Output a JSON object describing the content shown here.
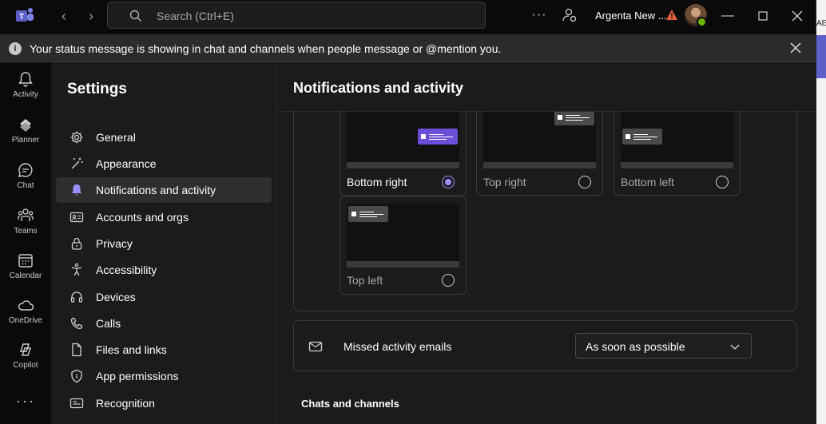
{
  "titlebar": {
    "search_placeholder": "Search (Ctrl+E)",
    "more_label": "···",
    "org_name": "Argenta New ..."
  },
  "right_strip": {
    "text": "AE"
  },
  "infobar": {
    "message": "Your status message is showing in chat and channels when people message or @mention you."
  },
  "rail": {
    "items": [
      {
        "label": "Activity",
        "icon": "bell-icon"
      },
      {
        "label": "Planner",
        "icon": "planner-icon"
      },
      {
        "label": "Chat",
        "icon": "chat-icon"
      },
      {
        "label": "Teams",
        "icon": "teams-icon"
      },
      {
        "label": "Calendar",
        "icon": "calendar-icon"
      },
      {
        "label": "OneDrive",
        "icon": "cloud-icon"
      },
      {
        "label": "Copilot",
        "icon": "copilot-icon"
      }
    ],
    "more": "···"
  },
  "settings": {
    "title": "Settings",
    "items": [
      {
        "label": "General",
        "icon": "gear-icon"
      },
      {
        "label": "Appearance",
        "icon": "magic-wand-icon"
      },
      {
        "label": "Notifications and activity",
        "icon": "bell-icon",
        "active": true
      },
      {
        "label": "Accounts and orgs",
        "icon": "id-card-icon"
      },
      {
        "label": "Privacy",
        "icon": "lock-icon"
      },
      {
        "label": "Accessibility",
        "icon": "accessibility-icon"
      },
      {
        "label": "Devices",
        "icon": "headset-icon"
      },
      {
        "label": "Calls",
        "icon": "phone-icon"
      },
      {
        "label": "Files and links",
        "icon": "document-icon"
      },
      {
        "label": "App permissions",
        "icon": "shield-icon"
      },
      {
        "label": "Recognition",
        "icon": "recognition-icon"
      }
    ]
  },
  "main": {
    "title": "Notifications and activity",
    "positions": [
      {
        "label": "Bottom right",
        "selected": true
      },
      {
        "label": "Top right",
        "selected": false
      },
      {
        "label": "Bottom left",
        "selected": false
      },
      {
        "label": "Top left",
        "selected": false
      }
    ],
    "missed": {
      "label": "Missed activity emails",
      "value": "As soon as possible"
    },
    "section_chats": "Chats and channels"
  },
  "colors": {
    "accent": "#5b5fc7",
    "selected_toast": "#6b4fd8",
    "radio_checked": "#9b8fff",
    "presence": "#6bb700",
    "warning": "#e8603c"
  }
}
